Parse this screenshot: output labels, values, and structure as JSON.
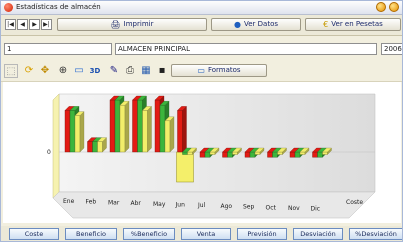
{
  "window": {
    "title": "Estadísticas de almacén"
  },
  "toolbar": {
    "print_label": "Imprimir",
    "view_data_label": "Ver Datos",
    "view_pesetas_label": "Ver en Pesetas",
    "formats_label": "Formatos"
  },
  "record": {
    "code": "1",
    "warehouse_name": "ALMACEN PRINCIPAL",
    "year": "2006"
  },
  "chart_data": {
    "type": "bar",
    "categories": [
      "Ene",
      "Feb",
      "Mar",
      "Abr",
      "May",
      "Jun",
      "Jul",
      "Ago",
      "Sep",
      "Oct",
      "Nov",
      "Dic"
    ],
    "series": [
      {
        "color": "#e21b14",
        "values": [
          8,
          2,
          10,
          10,
          10,
          8,
          -1,
          -1,
          -1,
          -1,
          -1,
          -1
        ]
      },
      {
        "color": "#3cb53c",
        "values": [
          8,
          2,
          10,
          10,
          9,
          0,
          -1,
          -1,
          -1,
          -1,
          -1,
          -1
        ]
      },
      {
        "color": "#f2ee6a",
        "values": [
          7,
          2,
          9,
          8,
          6,
          0,
          0,
          0,
          0,
          0,
          0,
          0
        ]
      }
    ],
    "z_labels": [
      "Coste"
    ],
    "y_ticks": [
      "0"
    ],
    "highlight_category": "Jun"
  },
  "tabs": [
    "Coste",
    "Beneficio",
    "%Beneficio",
    "Venta",
    "Previsión",
    "Desviación",
    "%Desviación"
  ]
}
